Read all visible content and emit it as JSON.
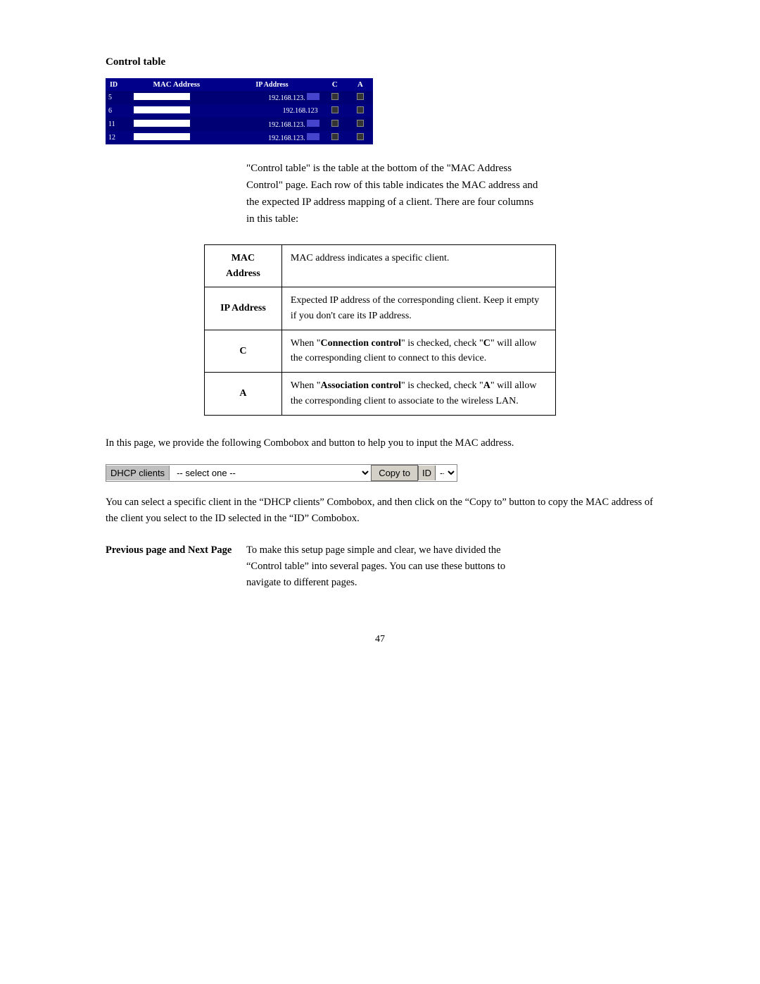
{
  "page": {
    "title": "Control table",
    "page_number": "47"
  },
  "router_table": {
    "headers": [
      "ID",
      "MAC Address",
      "IP Address",
      "C",
      "A"
    ],
    "rows": [
      {
        "id": "5",
        "ip": "192.168.123.",
        "has_ip_field": true
      },
      {
        "id": "6",
        "ip": "192.168.123",
        "has_ip_field": false
      },
      {
        "id": "11",
        "ip": "192.168.123.",
        "has_ip_field": true
      },
      {
        "id": "12",
        "ip": "192.168.123.",
        "has_ip_field": true
      }
    ]
  },
  "description": "\"Control table\" is the table at the bottom of the \"MAC Address Control\" page. Each row of this table indicates the MAC address and the expected IP address mapping of a client. There are four columns in this table:",
  "feature_table": {
    "rows": [
      {
        "label": "MAC Address",
        "description": "MAC address indicates a specific client."
      },
      {
        "label": "IP Address",
        "description": "Expected IP address of the corresponding client. Keep it empty if you don't care its IP address."
      },
      {
        "label": "C",
        "description_parts": [
          {
            "text": "When \"",
            "bold": false
          },
          {
            "text": "Connection control",
            "bold": true
          },
          {
            "text": "\" is checked, check \"",
            "bold": false
          },
          {
            "text": "C",
            "bold": true
          },
          {
            "text": "\" will allow the corresponding client to connect to this device.",
            "bold": false
          }
        ]
      },
      {
        "label": "A",
        "description_parts": [
          {
            "text": "When \"",
            "bold": false
          },
          {
            "text": "Association control",
            "bold": true
          },
          {
            "text": "\" is checked, check \"",
            "bold": false
          },
          {
            "text": "A",
            "bold": true
          },
          {
            "text": "\" will allow the corresponding client to associate to the wireless LAN.",
            "bold": false
          }
        ]
      }
    ]
  },
  "intro_para": "In this page, we provide the following Combobox and button to help you to input the MAC address.",
  "combobox": {
    "dhcp_label": "DHCP clients",
    "select_placeholder": "-- select one --",
    "copy_to_label": "Copy to",
    "id_label": "ID",
    "id_placeholder": "--"
  },
  "usage_para": "You can select a specific client in the “DHCP clients” Combobox, and then click on the “Copy to” button to copy the MAC address of the client you select to the ID selected in the “ID” Combobox.",
  "prevnext": {
    "label": "Previous page and Next Page",
    "description": "To make this setup page simple and clear, we have divided the “Control table” into several pages. You can use these buttons to navigate to different pages."
  }
}
